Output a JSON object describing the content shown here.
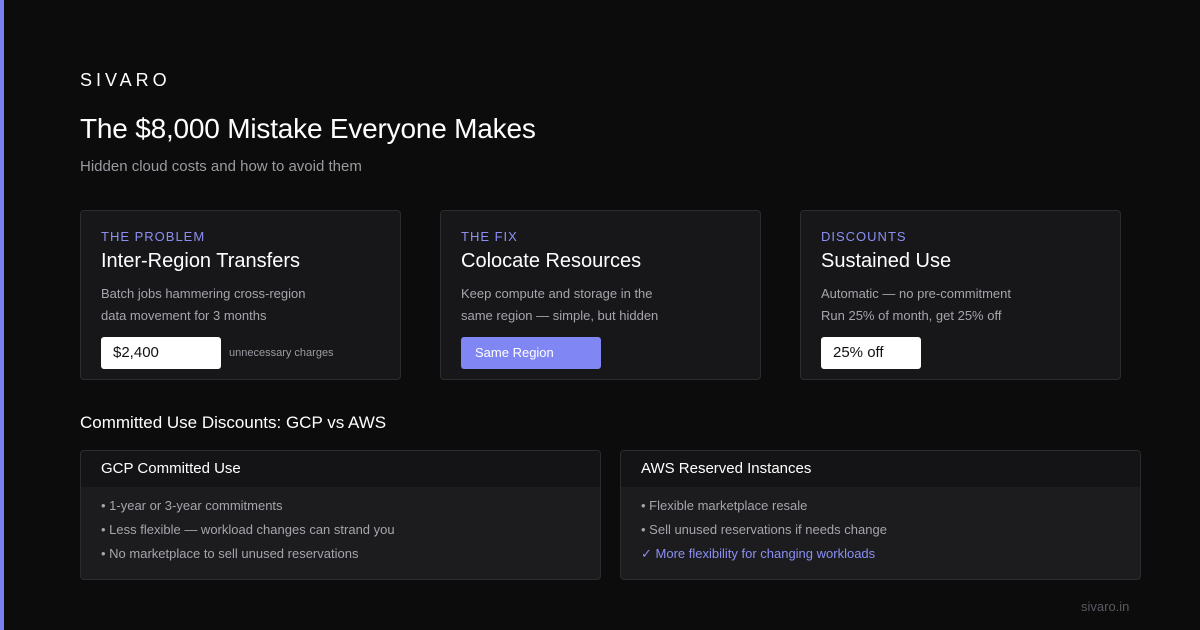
{
  "brand": "SIVARO",
  "title": "The $8,000 Mistake Everyone Makes",
  "subtitle": "Hidden cloud costs and how to avoid them",
  "cards": [
    {
      "kicker": "THE PROBLEM",
      "title": "Inter-Region Transfers",
      "desc": "Batch jobs hammering cross-region\ndata movement for 3 months",
      "pill": "$2,400",
      "note": "unnecessary charges"
    },
    {
      "kicker": "THE FIX",
      "title": "Colocate Resources",
      "desc": "Keep compute and storage in the\nsame region — simple, but hidden",
      "pill": "Same Region"
    },
    {
      "kicker": "DISCOUNTS",
      "title": "Sustained Use",
      "desc": "Automatic — no pre-commitment\nRun 25% of month, get 25% off",
      "pill": "25% off"
    }
  ],
  "section_title": "Committed Use Discounts: GCP vs AWS",
  "panels": [
    {
      "title": "GCP Committed Use",
      "items": [
        "• 1-year or 3-year commitments",
        "• Less flexible — workload changes can strand you",
        "• No marketplace to sell unused reservations"
      ]
    },
    {
      "title": "AWS Reserved Instances",
      "items": [
        "• Flexible marketplace resale",
        "• Sell unused reservations if needs change",
        "✓ More flexibility for changing workloads"
      ]
    }
  ],
  "footer": "sivaro.in",
  "colors": {
    "accent": "#8186f5",
    "background": "#0c0c0d",
    "card": "#17171a"
  }
}
